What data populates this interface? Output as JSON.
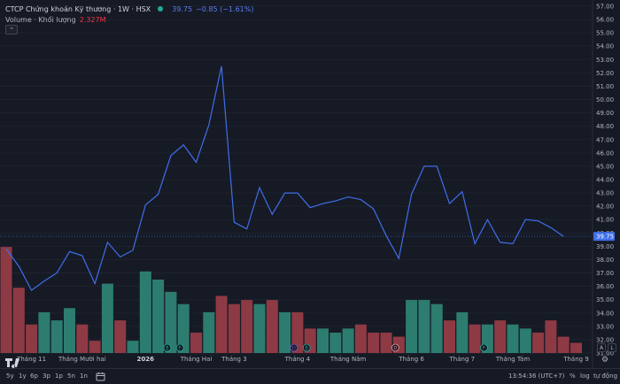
{
  "legend": {
    "symbol": "CTCP Chứng khoán Kỹ thương · 1W · HSX",
    "price": "39.75",
    "change": "−0.85 (−1.61%)",
    "volume_label": "Volume · Khối lượng",
    "volume_value": "2.327M"
  },
  "price_axis": {
    "ticks": [
      "57.00",
      "56.00",
      "55.00",
      "54.00",
      "53.00",
      "52.00",
      "51.00",
      "50.00",
      "49.00",
      "48.00",
      "47.00",
      "46.00",
      "45.00",
      "44.00",
      "43.00",
      "42.00",
      "41.00",
      "40.00",
      "39.00",
      "38.00",
      "37.00",
      "36.00",
      "35.00",
      "34.00",
      "33.00",
      "32.00",
      "31.00"
    ],
    "last_price_label": "39.75",
    "colors": {
      "line": "#3f6ee8",
      "label_bg": "#3f6ee8"
    }
  },
  "time_axis": {
    "labels": [
      {
        "text": "Tháng 11",
        "index": 2
      },
      {
        "text": "Tháng Mười hai",
        "index": 6
      },
      {
        "text": "2026",
        "index": 11
      },
      {
        "text": "Tháng Hai",
        "index": 15
      },
      {
        "text": "Tháng 3",
        "index": 18
      },
      {
        "text": "Tháng 4",
        "index": 23
      },
      {
        "text": "Tháng Năm",
        "index": 27
      },
      {
        "text": "Tháng 6",
        "index": 32
      },
      {
        "text": "Tháng 7",
        "index": 36
      },
      {
        "text": "Tháng Tám",
        "index": 40
      },
      {
        "text": "Tháng 9",
        "index": 45
      }
    ]
  },
  "chart_data": {
    "type": "line",
    "price": [
      38.8,
      37.5,
      35.7,
      36.4,
      37.0,
      38.6,
      38.3,
      36.2,
      39.3,
      38.2,
      38.7,
      42.1,
      42.9,
      45.8,
      46.6,
      45.3,
      48.1,
      52.5,
      40.8,
      40.3,
      43.4,
      41.4,
      43.0,
      43.0,
      41.9,
      42.2,
      42.4,
      42.7,
      42.5,
      41.8,
      39.8,
      38.1,
      42.9,
      45.0,
      45.0,
      42.2,
      43.1,
      39.2,
      41.0,
      39.3,
      39.2,
      41.0,
      40.9,
      40.4,
      39.75
    ],
    "volume": [
      2.6,
      1.6,
      0.7,
      1.0,
      0.8,
      1.1,
      0.7,
      0.3,
      1.7,
      0.8,
      0.3,
      2.0,
      1.8,
      1.5,
      1.2,
      0.5,
      1.0,
      1.4,
      1.2,
      1.3,
      1.2,
      1.3,
      1.0,
      1.0,
      0.6,
      0.6,
      0.5,
      0.6,
      0.7,
      0.5,
      0.5,
      0.4,
      1.3,
      1.3,
      1.2,
      0.8,
      1.0,
      0.7,
      0.7,
      0.8,
      0.7,
      0.6,
      0.5,
      0.8,
      0.4,
      0.25
    ],
    "volume_up": [
      false,
      false,
      false,
      true,
      true,
      true,
      false,
      false,
      true,
      false,
      true,
      true,
      true,
      true,
      true,
      false,
      true,
      false,
      false,
      false,
      true,
      false,
      true,
      false,
      false,
      true,
      true,
      true,
      false,
      false,
      false,
      false,
      true,
      true,
      true,
      false,
      true,
      false,
      true,
      false,
      true,
      true,
      false,
      false,
      false,
      false
    ],
    "ylim": [
      31,
      57
    ],
    "colors": {
      "up": "#2d7c70",
      "down": "#8e3a44"
    },
    "events": [
      {
        "label": "E",
        "index": 13,
        "color": "#22ab94"
      },
      {
        "label": "F",
        "index": 14,
        "color": "#22ab94"
      },
      {
        "label": "D",
        "index": 23,
        "color": "#7e57c2"
      },
      {
        "label": "E",
        "index": 24,
        "color": "#22ab94"
      },
      {
        "label": "D",
        "index": 31,
        "color": "#ef9a9a"
      },
      {
        "label": "F",
        "index": 38,
        "color": "#22ab94"
      }
    ]
  },
  "bottom_bar": {
    "ranges": [
      "5y",
      "1y",
      "6p",
      "3p",
      "1p",
      "5n",
      "1n"
    ],
    "time": "13:54:36 (UTC+7)",
    "percent": "%",
    "log": "log",
    "auto": "tự động"
  },
  "scale_buttons": {
    "a": "A",
    "l": "L"
  }
}
